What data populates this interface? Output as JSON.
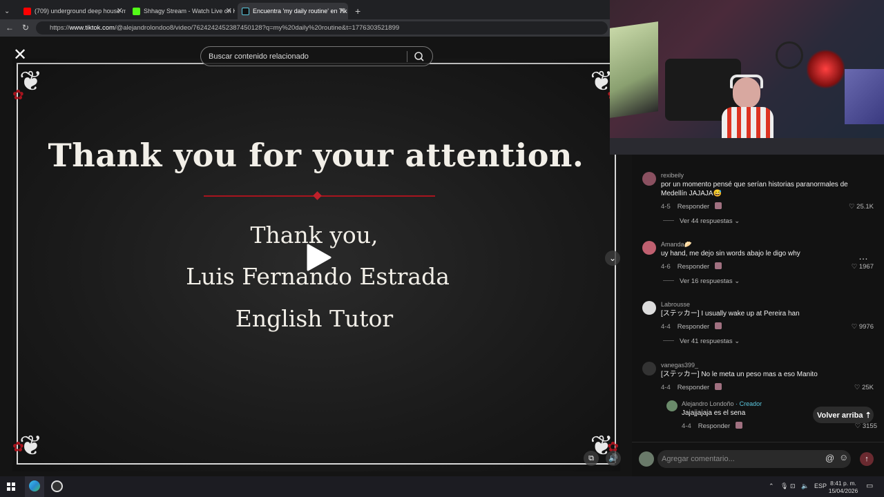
{
  "browser": {
    "tabs": [
      {
        "label": "(709) underground deep house m",
        "favicon_color": "#ff0000"
      },
      {
        "label": "Shhagy Stream - Watch Live on Ki",
        "favicon_color": "#53fc18"
      },
      {
        "label": "Encuentra 'my daily routine' en Tik",
        "favicon_color": "#111111"
      }
    ],
    "url_prefix": "https://",
    "url_domain": "www.tiktok.com",
    "url_rest": "/@alejandrolondoo8/video/7624242452387450128?q=my%20daily%20routine&t=1776303521899"
  },
  "video": {
    "search_placeholder": "Buscar contenido relacionado",
    "title": "Thank you for your attention.",
    "line1": "Thank you,",
    "line2": "Luis Fernando Estrada",
    "line3": "English Tutor",
    "accent_color": "#a8141e"
  },
  "comments": [
    {
      "user": "rexibeily",
      "text": "por un momento pensé que serían historias paranormales de Medellín JAJAJA😅",
      "date": "4-5",
      "reply": "Responder",
      "likes": "25.1K",
      "more": "Ver 44 respuestas"
    },
    {
      "user": "Amanda🥟",
      "text": "uy hand, me dejo sin words abajo le digo why",
      "date": "4-6",
      "reply": "Responder",
      "likes": "1967",
      "more": "Ver 16 respuestas"
    },
    {
      "user": "Labrousse",
      "text": "[ステッカー] I usually wake up at Pereira han",
      "date": "4-4",
      "reply": "Responder",
      "likes": "9976",
      "more": "Ver 41 respuestas"
    },
    {
      "user": "vanegas399_",
      "text": "[ステッカー] No le meta un peso mas a eso Manito",
      "date": "4-4",
      "reply": "Responder",
      "likes": "25K"
    }
  ],
  "creator_reply": {
    "user": "Alejandro Londoño",
    "tag": " · Creador",
    "text": "Jajajjajaja es el sena",
    "date": "4-4",
    "reply": "Responder",
    "likes": "3155"
  },
  "volver": "Volver arriba",
  "add_comment_placeholder": "Agregar comentario...",
  "taskbar": {
    "lang": "ESP",
    "time": "8:41 p. m.",
    "date": "15/04/2026"
  }
}
